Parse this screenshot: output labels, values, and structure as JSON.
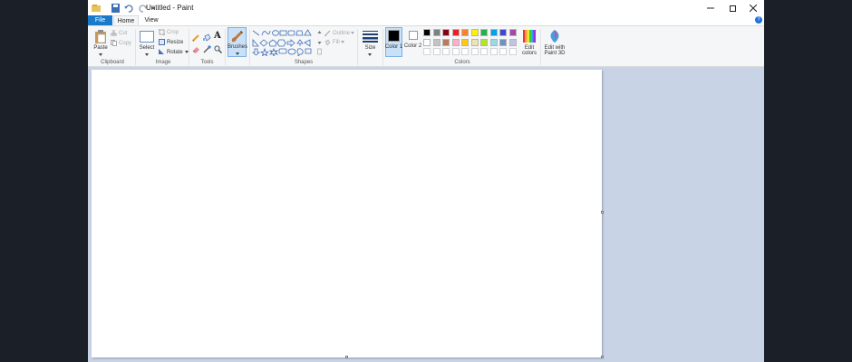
{
  "window": {
    "title": "Untitled - Paint",
    "controls": [
      "minimize",
      "maximize",
      "close"
    ]
  },
  "tabs": {
    "file": "File",
    "home": "Home",
    "view": "View",
    "help_symbol": "?"
  },
  "ribbon": {
    "clipboard": {
      "label": "Clipboard",
      "paste": "Paste",
      "cut": "Cut",
      "copy": "Copy"
    },
    "image": {
      "label": "Image",
      "select": "Select",
      "crop": "Crop",
      "resize": "Resize",
      "rotate": "Rotate"
    },
    "tools": {
      "label": "Tools"
    },
    "brushes": {
      "label": "Brushes"
    },
    "shapes": {
      "label": "Shapes",
      "outline": "Outline",
      "fill": "Fill"
    },
    "size": {
      "label": "Size"
    },
    "colors": {
      "label": "Colors",
      "color1": "Color 1",
      "color2": "Color 2",
      "edit_colors": "Edit colors",
      "edit_paint3d": "Edit with Paint 3D",
      "palette_row1": [
        "#000000",
        "#7f7f7f",
        "#880015",
        "#ed1c24",
        "#ff7f27",
        "#fff200",
        "#22b14c",
        "#00a2e8",
        "#3f48cc",
        "#a349a4"
      ],
      "palette_row2": [
        "#ffffff",
        "#c3c3c3",
        "#b97a57",
        "#ffaec9",
        "#ffc90e",
        "#efe4b0",
        "#b5e61d",
        "#99d9ea",
        "#7092be",
        "#c8bfe7"
      ],
      "color1_value": "#000000",
      "color2_value": "#ffffff"
    }
  },
  "accent": "#1979ca"
}
